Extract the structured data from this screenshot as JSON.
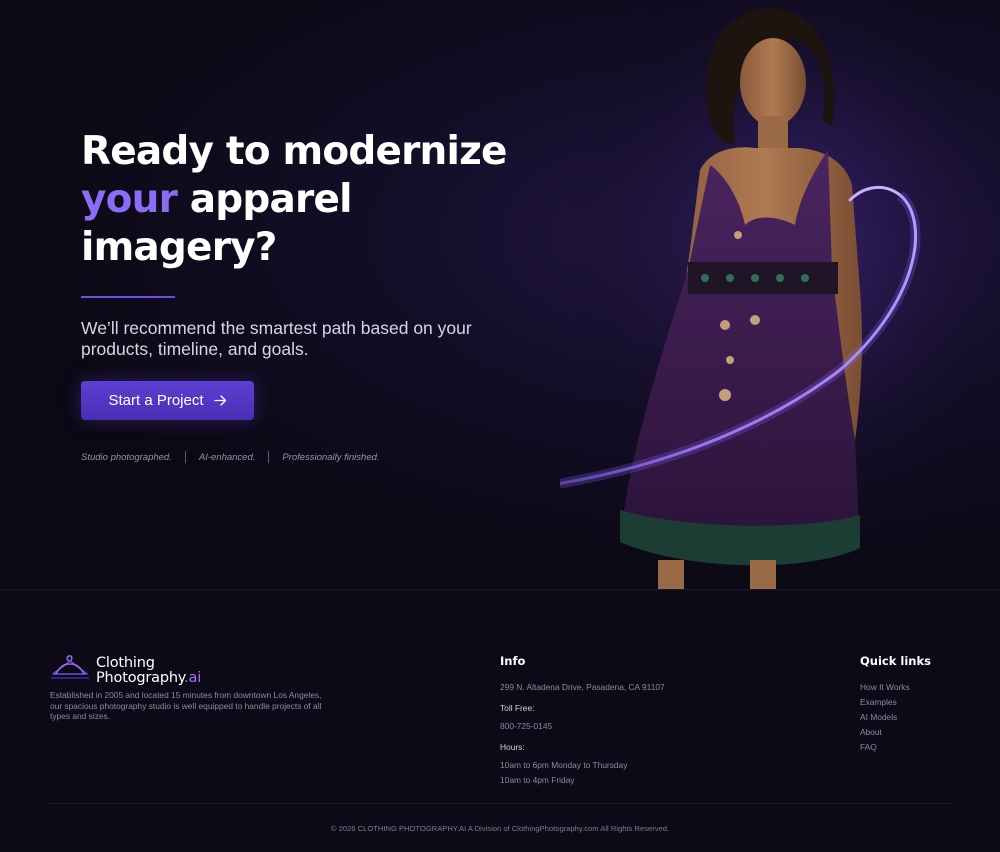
{
  "hero": {
    "headline_line1": "Ready to modernize",
    "headline_accent": "your",
    "headline_line2_rest": " apparel",
    "headline_line3": "imagery?",
    "subtext": "We’ll recommend the smartest path based on your products, timeline, and goals.",
    "cta_label": "Start a Project",
    "tags": [
      "Studio photographed.",
      "AI-enhanced.",
      "Professionally finished."
    ]
  },
  "footer": {
    "brand_line1": "Clothing",
    "brand_line2": "Photography",
    "brand_suffix": ".ai",
    "about": "Established in 2005 and located 15 minutes from downtown Los Angeles, our spacious photography studio is well equipped to handle projects of all types and sizes.",
    "info": {
      "title": "Info",
      "address": "299 N. Altadena Drive, Pasadena, CA 91107",
      "toll_free_label": "Toll Free:",
      "phone": "800-725-0145",
      "hours_label": "Hours:",
      "hours": [
        "10am to 6pm Monday to Thursday",
        "10am to 4pm Friday"
      ]
    },
    "quick_links": {
      "title": "Quick links",
      "items": [
        "How It Works",
        "Examples",
        "AI Models",
        "About",
        "FAQ"
      ]
    },
    "copyright": "© 2026 CLOTHING PHOTOGRAPHY.AI A Division of ClothingPhotography.com All Rights Reserved."
  },
  "colors": {
    "accent": "#8b6cf5",
    "button": "#5a3bd0",
    "background": "#0b0914",
    "brand_ai": "#b06cf5"
  }
}
